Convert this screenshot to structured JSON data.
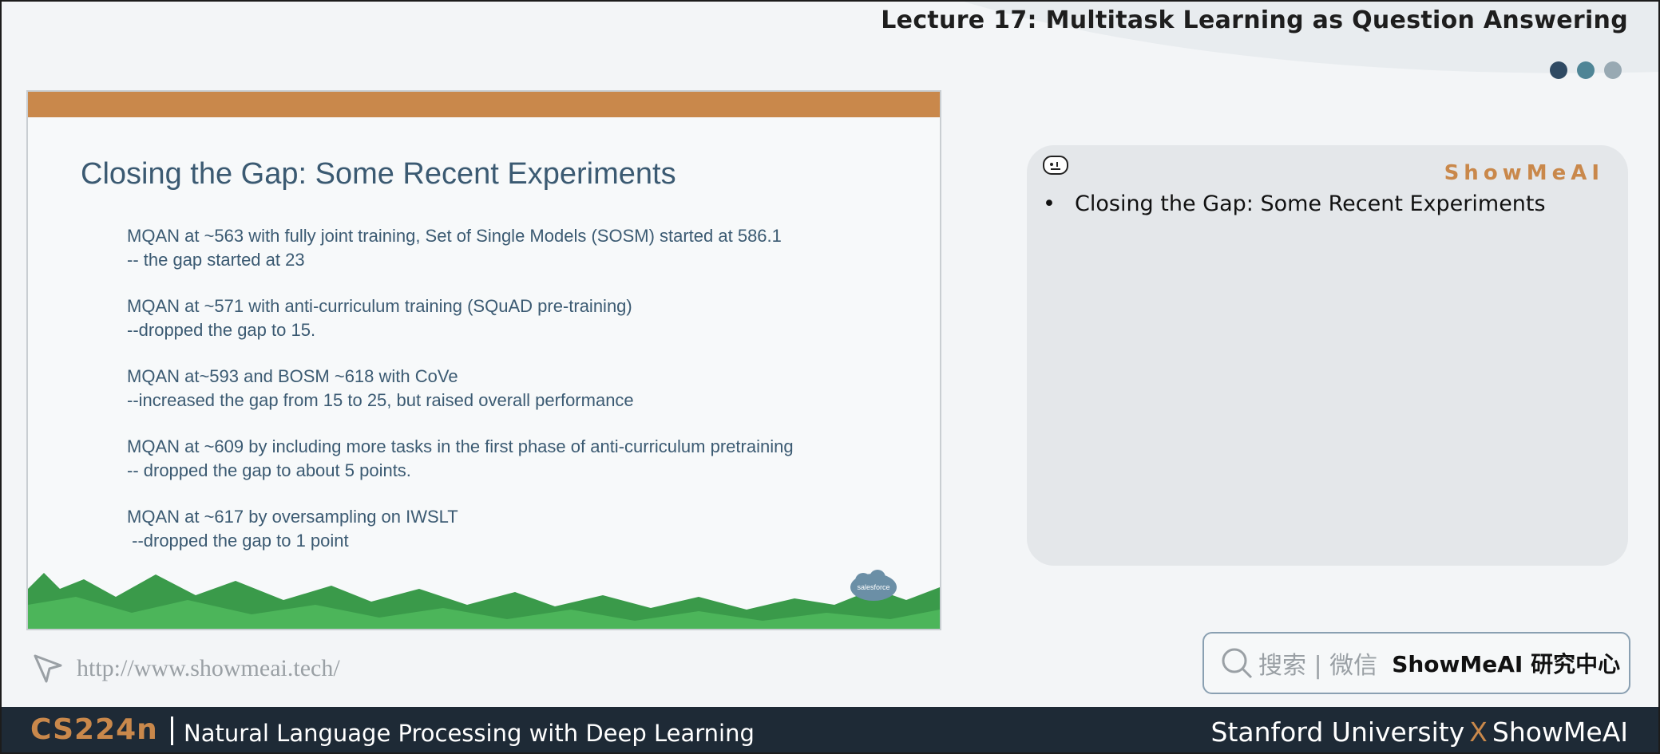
{
  "header": {
    "title": "Lecture 17: Multitask Learning as Question Answering",
    "dot_colors": [
      "#2f4a63",
      "#4f8596",
      "#98a9b3"
    ]
  },
  "slide": {
    "accent_color": "#c9884b",
    "title": "Closing the Gap: Some Recent Experiments",
    "bullets": [
      {
        "line1": "MQAN at ~563 with fully joint training, Set of Single Models (SOSM) started at 586.1",
        "line2": "-- the gap started at 23"
      },
      {
        "line1": "MQAN at ~571 with anti-curriculum training (SQuAD pre-training)",
        "line2": "--dropped the gap to 15."
      },
      {
        "line1": "MQAN at~593 and BOSM ~618 with CoVe",
        "line2": "--increased the gap from 15 to 25, but raised overall performance"
      },
      {
        "line1": "MQAN at ~609 by including more tasks in the first phase of anti-curriculum pretraining",
        "line2": "-- dropped the gap to about 5 points."
      },
      {
        "line1": "MQAN at ~617 by oversampling on IWSLT",
        "line2": " --dropped the gap to 1 point"
      }
    ],
    "logo_text": "salesforce"
  },
  "notes": {
    "brand": "ShowMeAI",
    "item": "Closing the Gap: Some Recent Experiments"
  },
  "url": "http://www.showmeai.tech/",
  "search": {
    "placeholder": "搜索 | 微信",
    "brand": "ShowMeAI 研究中心"
  },
  "footer": {
    "course_code": "CS224n",
    "course_name": "Natural Language Processing with Deep Learning",
    "left_org": "Stanford University",
    "x": "X",
    "right_org": "ShowMeAI"
  }
}
